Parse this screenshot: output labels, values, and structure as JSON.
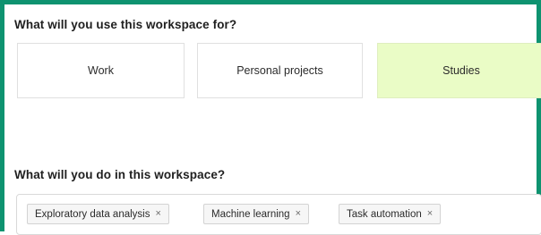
{
  "question_use": "What will you use this workspace for?",
  "use_options": [
    {
      "label": "Work",
      "selected": false
    },
    {
      "label": "Personal projects",
      "selected": false
    },
    {
      "label": "Studies",
      "selected": true
    }
  ],
  "question_do": "What will you do in this workspace?",
  "tags": [
    {
      "label": "Exploratory data analysis",
      "remove": "×"
    },
    {
      "label": "Machine learning",
      "remove": "×"
    },
    {
      "label": "Task automation",
      "remove": "×"
    }
  ],
  "colors": {
    "frame_border": "#0e9370",
    "selected_option_bg": "#eafcc6",
    "tag_bg": "#f6f6f6"
  }
}
